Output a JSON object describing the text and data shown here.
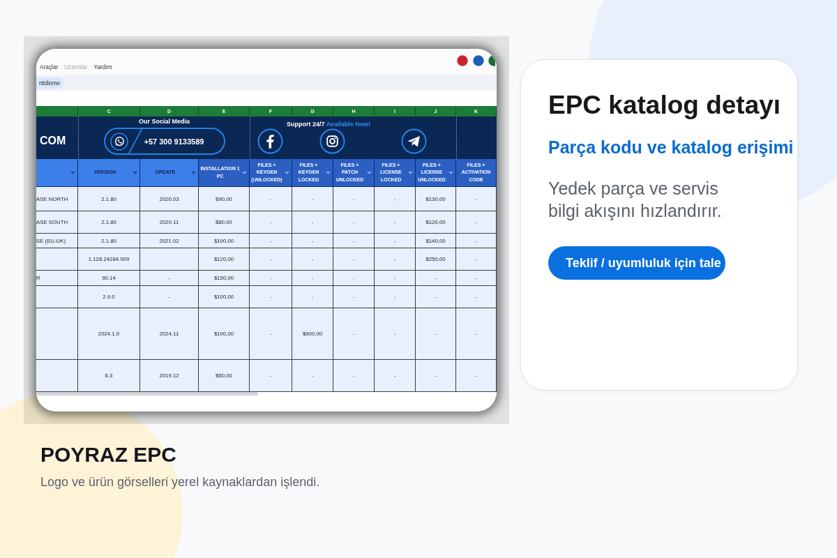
{
  "product_image": {
    "menu": [
      {
        "label": "Araçlar",
        "disabled": false
      },
      {
        "label": "Uzantılar",
        "disabled": true
      },
      {
        "label": "Yardım",
        "disabled": false
      }
    ],
    "toolbar_tab": "ntüleme",
    "banner": {
      "brand": "COM",
      "social_title": "Our Social Media",
      "phone": "+57 300 9133589",
      "support_title": "Support 24/7",
      "support_highlight": "Available Now!"
    },
    "table": {
      "columns": [
        {
          "filter": true
        },
        {
          "letter": "C",
          "label": "VERSION",
          "filter": true
        },
        {
          "letter": "D",
          "label": "UPDATE",
          "filter": true
        },
        {
          "letter": "E",
          "label": "INSTALLATION 1 PC",
          "filter": true
        },
        {
          "letter": "F",
          "label": "FILES + KEYGEN (UNLOCKED)",
          "filter": true
        },
        {
          "letter": "G",
          "label": "FILES + KEYGEN LOCKED",
          "filter": true
        },
        {
          "letter": "H",
          "label": "FILES + PATCH UNLOCKED",
          "filter": true
        },
        {
          "letter": "I",
          "label": "FILES + LICENSE LOCKED",
          "filter": true
        },
        {
          "letter": "J",
          "label": "FILES + LICENSE UNLOCKED",
          "filter": true
        },
        {
          "letter": "K",
          "label": "FILES + ACTIVATION CODE",
          "filter": false
        }
      ],
      "rows": [
        [
          "ASE NORTH",
          "2.1.80",
          "2020.03",
          "$90,00",
          "-",
          "-",
          "-",
          "-",
          "$130,00",
          "-"
        ],
        [
          "ASE SOUTH",
          "2.1.80",
          "2020.11",
          "$80,00",
          "-",
          "-",
          "-",
          "-",
          "$120,00",
          "-"
        ],
        [
          "SE (EU-UK)",
          "2.1.80",
          "2021.02",
          "$100,00",
          "-",
          "-",
          "-",
          "-",
          "$140,00",
          "-"
        ],
        [
          null,
          "1.128.24284.909",
          null,
          "$120,00",
          "-",
          "-",
          "-",
          "-",
          "$250,00",
          "-"
        ],
        [
          "R",
          "90.14",
          "-",
          "$150,00",
          "-",
          "-",
          "-",
          "-",
          "-",
          "-"
        ],
        [
          null,
          "2.9.0",
          "-",
          "$100,00",
          "-",
          "-",
          "-",
          "-",
          "-",
          "-"
        ],
        [
          null,
          "2024.1.0",
          "2024.11",
          "$100,00",
          "-",
          "$900,00",
          "-",
          "-",
          "-",
          "-"
        ],
        [
          null,
          "6.3",
          "2019.12",
          "$60,00",
          "-",
          "-",
          "-",
          "-",
          "-",
          "-"
        ]
      ]
    }
  },
  "detail_card": {
    "title": "EPC katalog detayı",
    "subtitle": "Parça kodu ve katalog erişimi",
    "description": "Yedek parça ve servis bilgi akışını hızlandırır.",
    "button": "Teklif / uyumluluk için tale"
  },
  "caption": {
    "title": "POYRAZ EPC",
    "text": "Logo ve ürün görselleri yerel kaynaklardan işlendi."
  }
}
